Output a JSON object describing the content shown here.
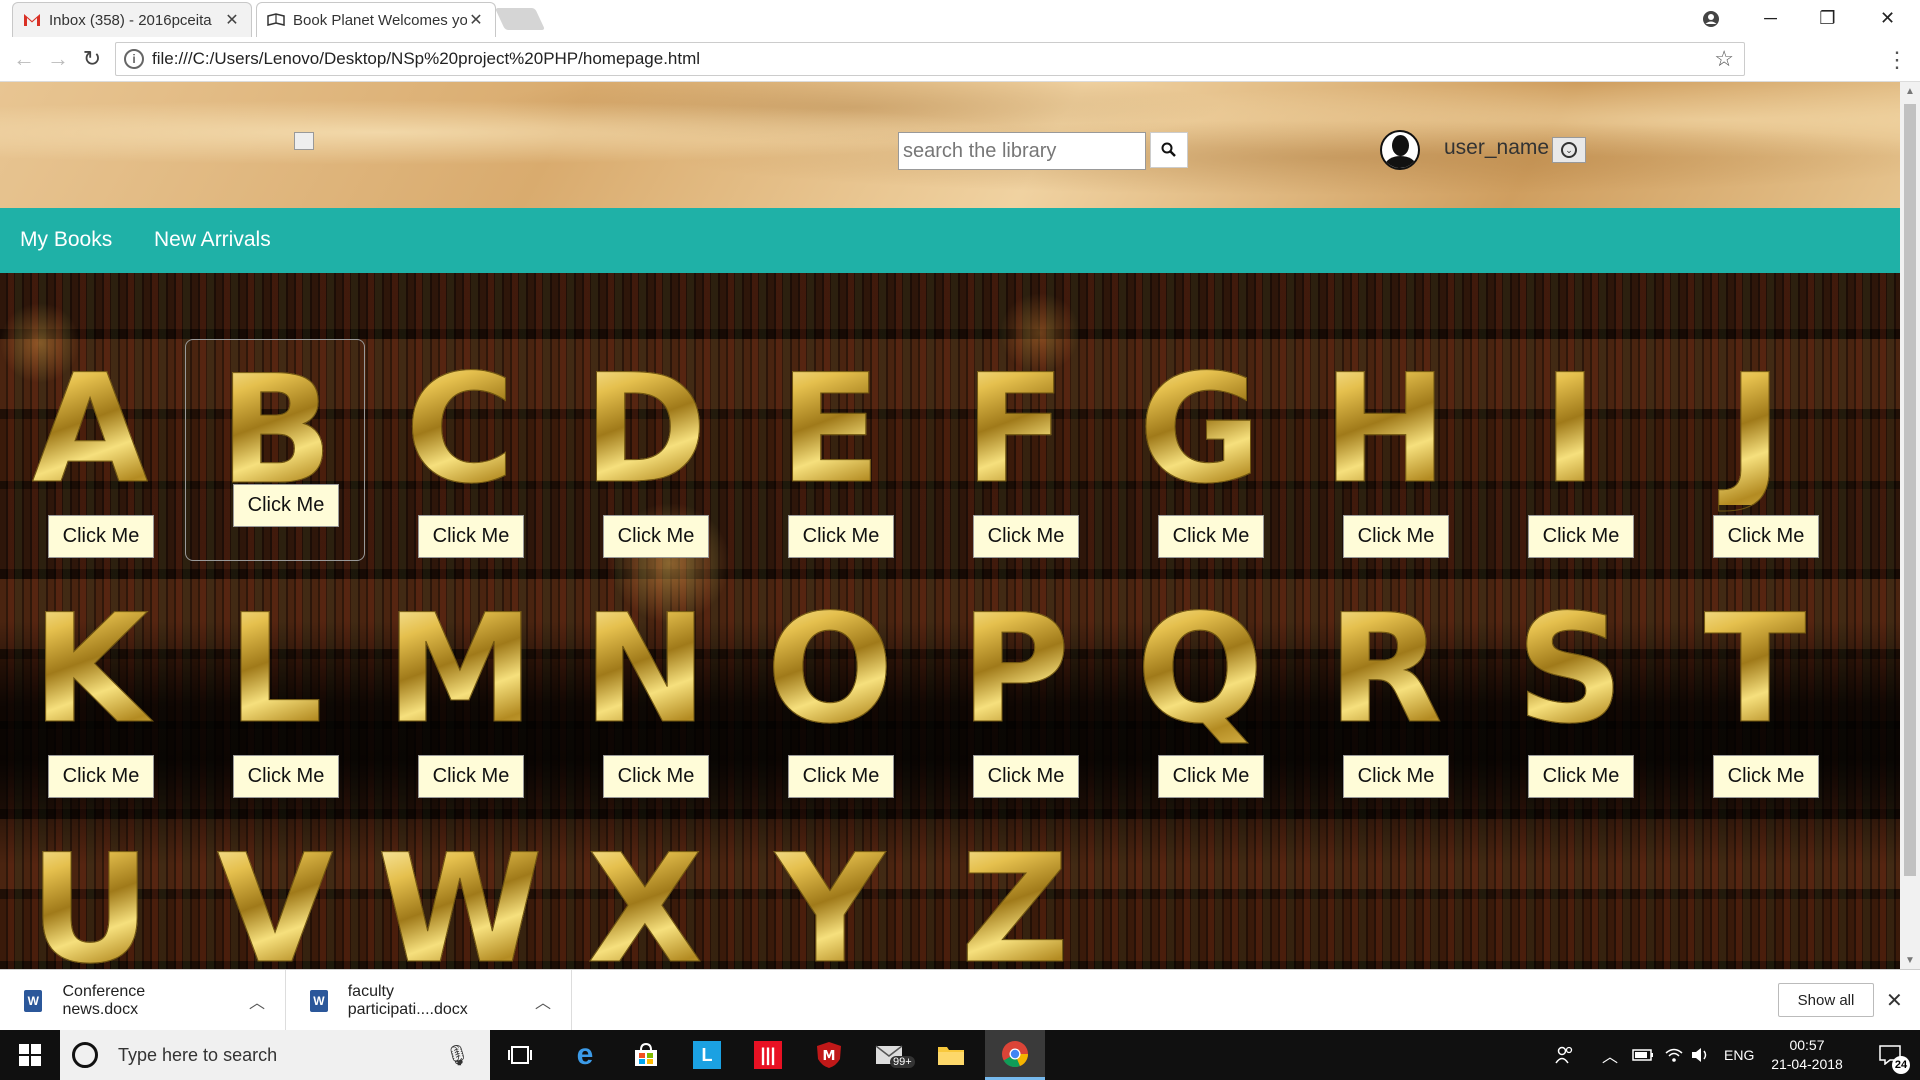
{
  "browser": {
    "tabs": [
      {
        "title": "Inbox (358) - 2016pceita",
        "icon": "gmail-icon"
      },
      {
        "title": "Book Planet Welcomes yo",
        "icon": "book-icon"
      }
    ],
    "url": "file:///C:/Users/Lenovo/Desktop/NSp%20project%20PHP/homepage.html"
  },
  "header": {
    "search_placeholder": "search the library",
    "username": "user_name"
  },
  "nav": {
    "items": [
      "My Books",
      "New Arrivals"
    ]
  },
  "library": {
    "button_label": "Click Me",
    "letters": [
      "A",
      "B",
      "C",
      "D",
      "E",
      "F",
      "G",
      "H",
      "I",
      "J",
      "K",
      "L",
      "M",
      "N",
      "O",
      "P",
      "Q",
      "R",
      "S",
      "T",
      "U",
      "V",
      "W",
      "X",
      "Y",
      "Z"
    ]
  },
  "downloads": {
    "items": [
      "Conference news.docx",
      "faculty participati....docx"
    ],
    "show_all": "Show all"
  },
  "taskbar": {
    "search_placeholder": "Type here to search",
    "language": "ENG",
    "time": "00:57",
    "date": "21-04-2018",
    "notification_count": "24",
    "mail_badge": "99+"
  },
  "colors": {
    "nav_teal": "#1fb1a7",
    "button_cream": "#fffcd8",
    "letter_gold": "#e5c04e"
  }
}
